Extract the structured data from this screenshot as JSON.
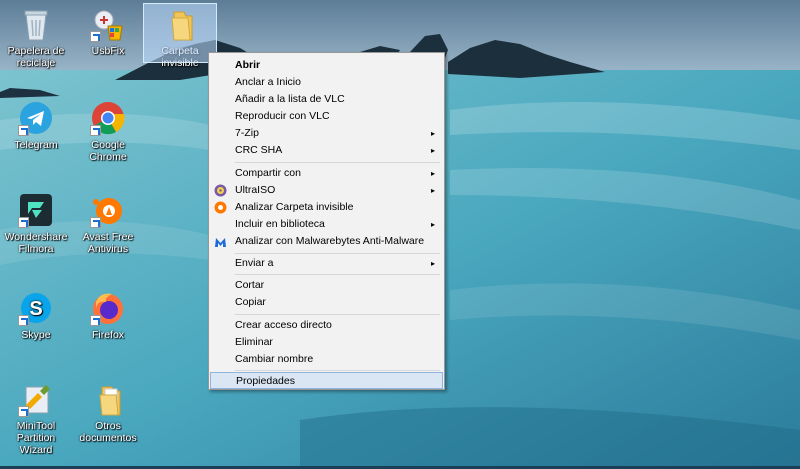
{
  "desktop": {
    "icons": [
      {
        "label": "Papelera de reciclaje",
        "icon": "recycle-bin-icon"
      },
      {
        "label": "UsbFix",
        "icon": "usbfix-icon"
      },
      {
        "label": "Carpeta invisible",
        "icon": "folder-icon",
        "selected": true
      },
      {
        "label": "Telegram",
        "icon": "telegram-icon"
      },
      {
        "label": "Google Chrome",
        "icon": "chrome-icon"
      },
      {
        "label": "Wondershare Filmora",
        "icon": "filmora-icon"
      },
      {
        "label": "Avast Free Antivirus",
        "icon": "avast-icon"
      },
      {
        "label": "Skype",
        "icon": "skype-icon"
      },
      {
        "label": "Firefox",
        "icon": "firefox-icon"
      },
      {
        "label": "MiniTool Partition Wizard",
        "icon": "minitool-icon"
      },
      {
        "label": "Otros documentos",
        "icon": "folder-icon"
      }
    ]
  },
  "context_menu": {
    "groups": [
      [
        {
          "label": "Abrir",
          "bold": true
        },
        {
          "label": "Anclar a Inicio"
        },
        {
          "label": "Añadir a la lista de VLC"
        },
        {
          "label": "Reproducir con VLC"
        },
        {
          "label": "7-Zip",
          "submenu": true
        },
        {
          "label": "CRC SHA",
          "submenu": true
        }
      ],
      [
        {
          "label": "Compartir con",
          "submenu": true
        },
        {
          "label": "UltraISO",
          "submenu": true,
          "icon": "ultraiso-icon"
        },
        {
          "label": "Analizar Carpeta invisible",
          "icon": "avast-icon"
        },
        {
          "label": "Incluir en biblioteca",
          "submenu": true
        },
        {
          "label": "Analizar con Malwarebytes Anti-Malware",
          "icon": "malwarebytes-icon"
        }
      ],
      [
        {
          "label": "Enviar a",
          "submenu": true
        }
      ],
      [
        {
          "label": "Cortar"
        },
        {
          "label": "Copiar"
        }
      ],
      [
        {
          "label": "Crear acceso directo"
        },
        {
          "label": "Eliminar"
        },
        {
          "label": "Cambiar nombre"
        }
      ],
      [
        {
          "label": "Propiedades",
          "hover": true
        }
      ]
    ],
    "submenu_arrow": "▸",
    "highlight_color": "#dbe6f4"
  }
}
